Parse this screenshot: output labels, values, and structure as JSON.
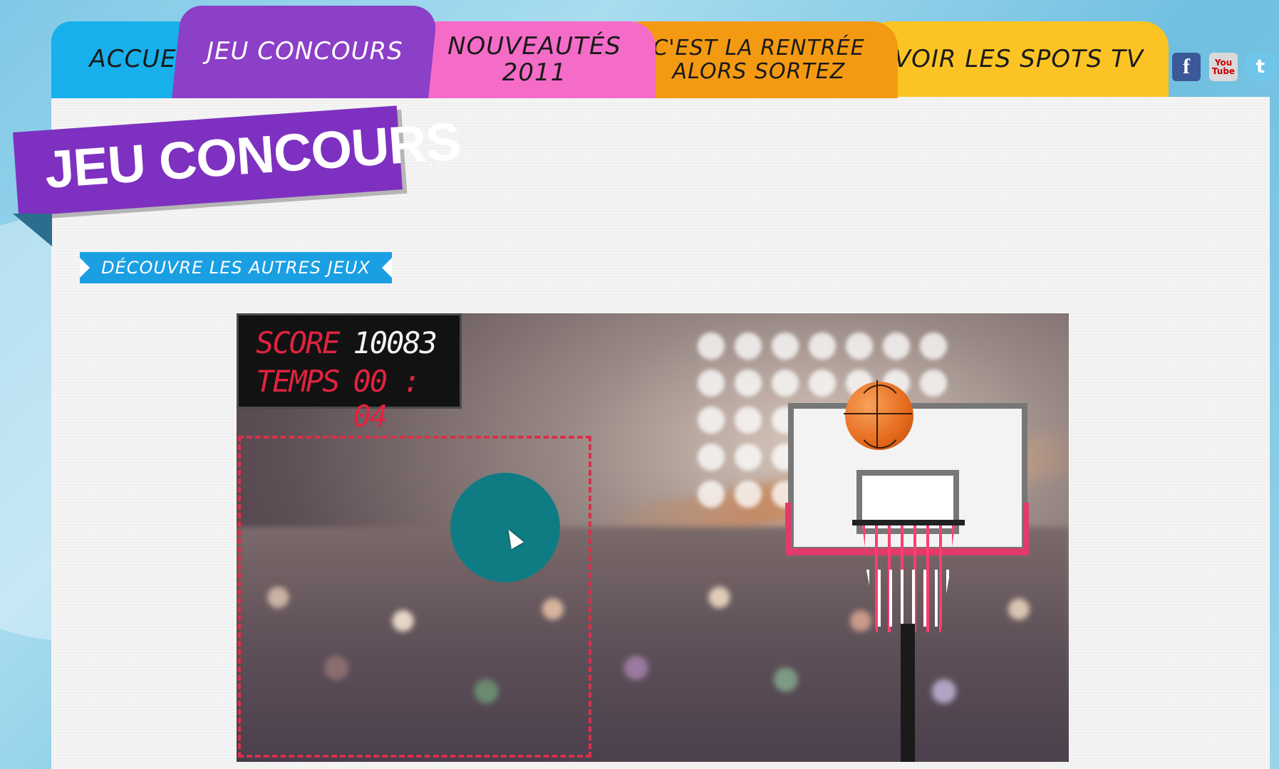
{
  "nav": {
    "tabs": [
      {
        "label": "ACCUEIL",
        "color": "#17b0ec"
      },
      {
        "label": "JEU CONCOURS",
        "color": "#8c3fc7"
      },
      {
        "label": "NOUVEAUTÉS 2011",
        "color": "#f56cc8"
      },
      {
        "label_line1": "C'EST LA RENTRÉE",
        "label_line2": "ALORS SORTEZ",
        "color": "#f49a12"
      },
      {
        "label": "VOIR LES SPOTS TV",
        "color": "#fbc424"
      }
    ],
    "social": {
      "facebook": "f",
      "youtube_line1": "You",
      "youtube_line2": "Tube",
      "twitter": "t"
    }
  },
  "page": {
    "title": "JEU CONCOURS",
    "discover_button": "DÉCOUVRE LES AUTRES JEUX"
  },
  "game": {
    "score_label": "SCORE",
    "score_value": "10083",
    "time_label": "TEMPS",
    "time_value": "00 : 04"
  },
  "colors": {
    "accent_purple": "#7e31c0",
    "button_blue": "#1a9fe3",
    "score_red": "#e0233f",
    "control_teal": "#0f7c84"
  }
}
